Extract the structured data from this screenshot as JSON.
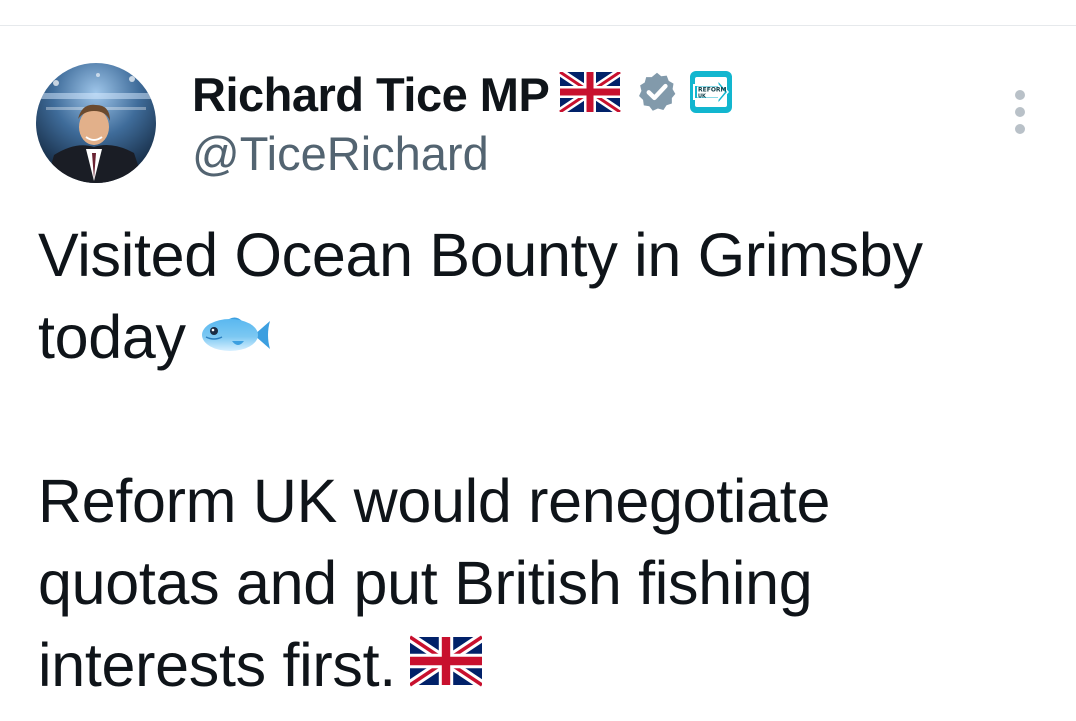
{
  "author": {
    "display_name": "Richard Tice MP",
    "handle": "@TiceRichard",
    "name_flag_icon": "union-jack-flag-icon",
    "verified_icon": "verified-badge-icon",
    "affiliate_icon": "reform-uk-affiliate-icon",
    "affiliate_text": "REFORM UK",
    "avatar": "profile-photo"
  },
  "menu": {
    "icon": "more-options-icon"
  },
  "tweet": {
    "line1": "Visited Ocean Bounty in Grimsby",
    "line2": "today",
    "line2_emoji": "fish-emoji",
    "line3": "Reform UK would renegotiate",
    "line4": "quotas and put British fishing",
    "line5": "interests first.",
    "line5_emoji": "union-jack-flag-emoji"
  },
  "colors": {
    "text": "#0f1419",
    "secondary_text": "#536471",
    "verified_grey": "#829aab",
    "affiliate_teal": "#12b6cf"
  }
}
